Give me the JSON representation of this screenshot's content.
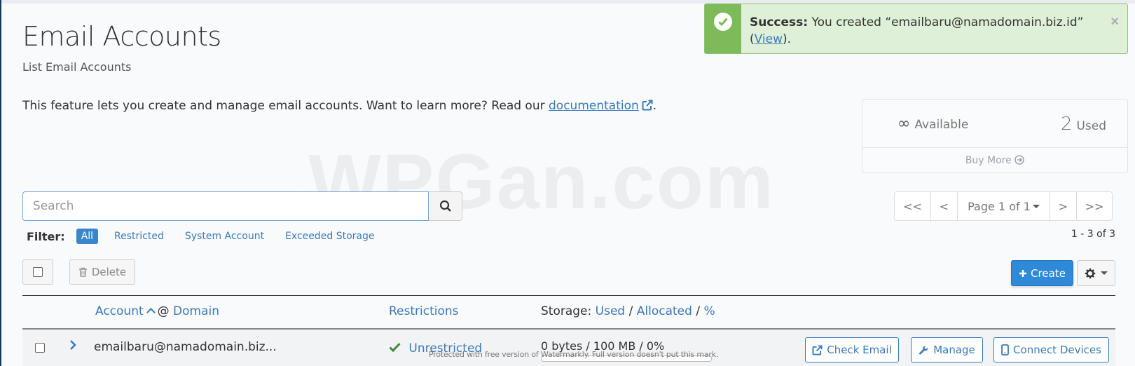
{
  "header": {
    "title": "Email Accounts",
    "subtitle": "List Email Accounts"
  },
  "intro": {
    "text": "This feature lets you create and manage email accounts. Want to learn more? Read our ",
    "link": "documentation",
    "suffix": "."
  },
  "alert": {
    "type": "success",
    "prefix": "Success:",
    "message": " You created “emailbaru@namadomain.biz.id”",
    "open_paren": "(",
    "link": "View",
    "close": ").",
    "close_icon": "×",
    "color": "#7cba5a"
  },
  "stats": {
    "available_symbol": "∞",
    "available_label": "Available",
    "used_value": "2",
    "used_label": "Used",
    "buy_more": "Buy More"
  },
  "watermark": "WPGan.com",
  "search": {
    "placeholder": "Search",
    "value": ""
  },
  "filter": {
    "label": "Filter:",
    "options": [
      "All",
      "Restricted",
      "System Account",
      "Exceeded Storage"
    ],
    "active": "All"
  },
  "pagination": {
    "first": "<<",
    "prev": "<",
    "page_label": "Page 1 of 1",
    "next": ">",
    "last": ">>",
    "range": "1 - 3 of 3"
  },
  "toolbar": {
    "delete_label": "Delete",
    "create_label": "Create",
    "accent": "#2e8ad8"
  },
  "table": {
    "headers": {
      "account": "Account",
      "at": "@",
      "domain": "Domain",
      "restrictions": "Restrictions",
      "storage_prefix": "Storage:",
      "used": "Used",
      "sep1": "/",
      "allocated": "Allocated",
      "sep2": "/",
      "percent": "%"
    },
    "rows": [
      {
        "account": "emailbaru@namadomain.biz...",
        "restriction": "Unrestricted",
        "storage": "0 bytes / 100 MB / 0%",
        "storage_fraction": 0,
        "actions": [
          "Check Email",
          "Manage",
          "Connect Devices"
        ]
      }
    ]
  },
  "notice": "Protected with free version of Watermarkly. Full version doesn't put this mark."
}
